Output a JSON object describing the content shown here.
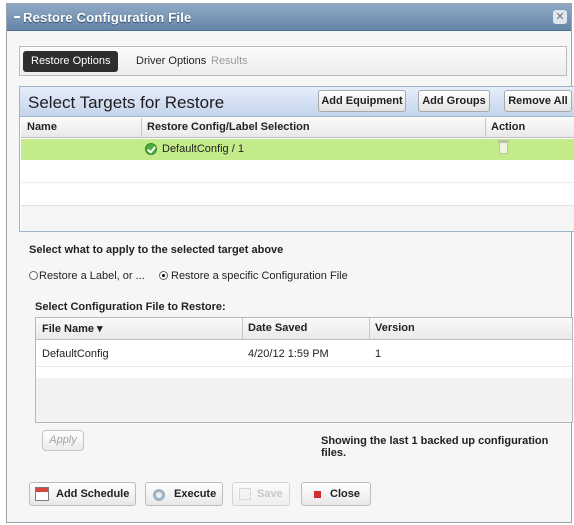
{
  "window": {
    "title": "Restore Configuration File",
    "close_glyph": "✕"
  },
  "tabs": [
    {
      "label": "Restore Options",
      "active": true
    },
    {
      "label": "Driver Options",
      "active": false
    },
    {
      "label": "Results",
      "active": false,
      "disabled": true
    }
  ],
  "targets": {
    "title": "Select Targets for Restore",
    "buttons": {
      "add_equipment": "Add Equipment",
      "add_groups": "Add Groups",
      "remove_all": "Remove All"
    },
    "columns": [
      "Name",
      "Restore Config/Label Selection",
      "Action"
    ],
    "rows": [
      {
        "name": "",
        "selection": "DefaultConfig / 1",
        "status_icon": "check-circle-icon",
        "action_icon": "trash-icon"
      }
    ]
  },
  "apply_section": {
    "label": "Select what to apply to the selected target above",
    "options": [
      {
        "label": "Restore a Label, or ...",
        "selected": false
      },
      {
        "label": "Restore a specific Configuration File",
        "selected": true
      }
    ]
  },
  "files": {
    "label": "Select Configuration File to Restore:",
    "columns": [
      "File Name ▾",
      "Date Saved",
      "Version"
    ],
    "rows": [
      {
        "file_name": "DefaultConfig",
        "date_saved": "4/20/12 1:59 PM",
        "version": "1"
      }
    ],
    "apply_label": "Apply",
    "showing_text": "Showing the last 1 backed up configuration files."
  },
  "footer": {
    "add_schedule": "Add Schedule",
    "execute": "Execute",
    "save": "Save",
    "close": "Close"
  },
  "colors": {
    "selected_row": "#c4eb8a",
    "titlebar": "#7796b6",
    "tab_active": "#2e2e2e"
  }
}
